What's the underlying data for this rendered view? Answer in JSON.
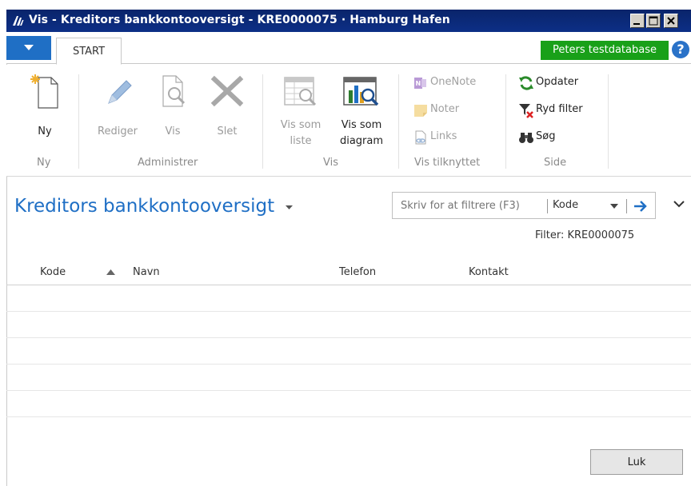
{
  "window": {
    "title": "Vis - Kreditors bankkontooversigt - KRE0000075 · Hamburg Hafen"
  },
  "tabs": {
    "start": "START"
  },
  "database_badge": "Peters testdatabase",
  "ribbon": {
    "ny": {
      "label": "Ny",
      "group": "Ny"
    },
    "administrer": {
      "group": "Administrer",
      "rediger": "Rediger",
      "vis": "Vis",
      "slet": "Slet"
    },
    "vis_group": {
      "group": "Vis",
      "vis_som_liste_1": "Vis som",
      "vis_som_liste_2": "liste",
      "vis_som_diagram_1": "Vis som",
      "vis_som_diagram_2": "diagram"
    },
    "vis_tilknyttet": {
      "group": "Vis tilknyttet",
      "onenote": "OneNote",
      "noter": "Noter",
      "links": "Links"
    },
    "side": {
      "group": "Side",
      "opdater": "Opdater",
      "ryd_filter": "Ryd filter",
      "sog": "Søg"
    }
  },
  "page": {
    "title": "Kreditors bankkontooversigt",
    "filter": "Filter: KRE0000075"
  },
  "search": {
    "placeholder": "Skriv for at filtrere (F3)",
    "field": "Kode"
  },
  "grid": {
    "columns": [
      "Kode",
      "Navn",
      "Telefon",
      "Kontakt"
    ]
  },
  "buttons": {
    "close": "Luk"
  },
  "colors": {
    "accent": "#1f6fc5",
    "badge": "#19a019",
    "titlebar": "#0a246a"
  }
}
